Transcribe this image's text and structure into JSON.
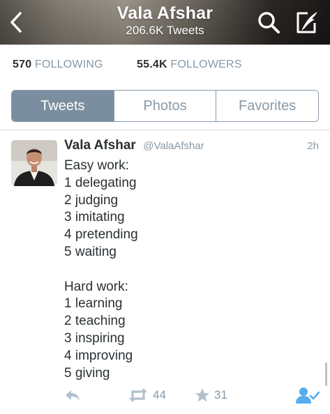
{
  "header": {
    "title": "Vala Afshar",
    "subtitle": "206.6K Tweets"
  },
  "stats": {
    "following_count": "570",
    "following_label": "FOLLOWING",
    "followers_count": "55.4K",
    "followers_label": "FOLLOWERS"
  },
  "tabs": [
    {
      "label": "Tweets",
      "active": true
    },
    {
      "label": "Photos",
      "active": false
    },
    {
      "label": "Favorites",
      "active": false
    }
  ],
  "tweet": {
    "name": "Vala Afshar",
    "handle": "@ValaAfshar",
    "time": "2h",
    "lines": [
      "Easy work:",
      "1 delegating",
      "2 judging",
      "3 imitating",
      "4 pretending",
      "5 waiting",
      "",
      "Hard work:",
      "1 learning",
      "2 teaching",
      "3 inspiring",
      "4 improving",
      "5 giving"
    ],
    "retweet_count": "44",
    "favorite_count": "31"
  },
  "colors": {
    "active_tab": "#7a8e9f",
    "muted_text": "#8899a6",
    "follow_icon": "#55acee"
  },
  "icons": [
    "back-arrow-icon",
    "search-icon",
    "compose-icon",
    "reply-icon",
    "retweet-icon",
    "star-icon",
    "following-user-icon"
  ]
}
